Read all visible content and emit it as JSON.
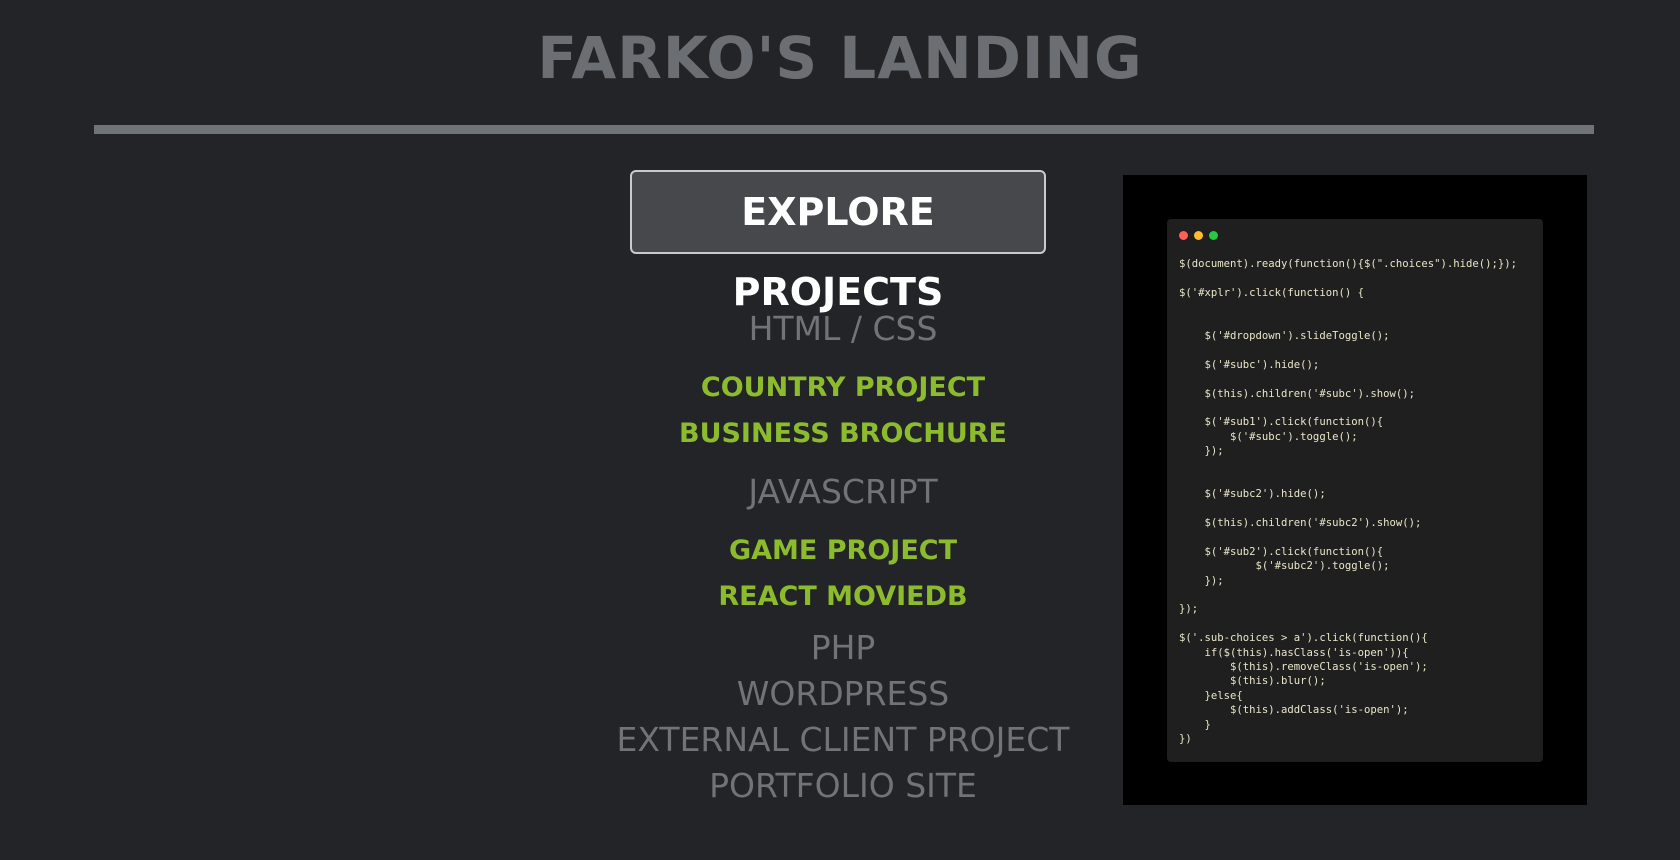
{
  "header": {
    "title": "FARKO'S LANDING"
  },
  "explore_button": {
    "label": "EXPLORE PROJECTS"
  },
  "menu": {
    "categories": [
      "HTML / CSS",
      "JAVASCRIPT",
      "PHP",
      "WORDPRESS",
      "EXTERNAL CLIENT PROJECT",
      "PORTFOLIO SITE"
    ],
    "projects": [
      "COUNTRY PROJECT",
      "BUSINESS BROCHURE",
      "GAME PROJECT",
      "REACT MOVIEDB"
    ]
  },
  "code_window": {
    "dot_colors": [
      "#ff5f56",
      "#ffbd2e",
      "#27c93f"
    ],
    "lines": [
      "$(document).ready(function(){$(\".choices\").hide();});",
      "",
      "$('#xplr').click(function() {",
      "",
      "",
      "    $('#dropdown').slideToggle();",
      "",
      "    $('#subc').hide();",
      "",
      "    $(this).children('#subc').show();",
      "",
      "    $('#sub1').click(function(){",
      "        $('#subc').toggle();",
      "    });",
      "",
      "",
      "    $('#subc2').hide();",
      "",
      "    $(this).children('#subc2').show();",
      "",
      "    $('#sub2').click(function(){",
      "            $('#subc2').toggle();",
      "    });",
      "",
      "});",
      "",
      "$('.sub-choices > a').click(function(){",
      "    if($(this).hasClass('is-open')){",
      "        $(this).removeClass('is-open');",
      "        $(this).blur();",
      "    }else{",
      "        $(this).addClass('is-open');",
      "    }",
      "})"
    ]
  }
}
